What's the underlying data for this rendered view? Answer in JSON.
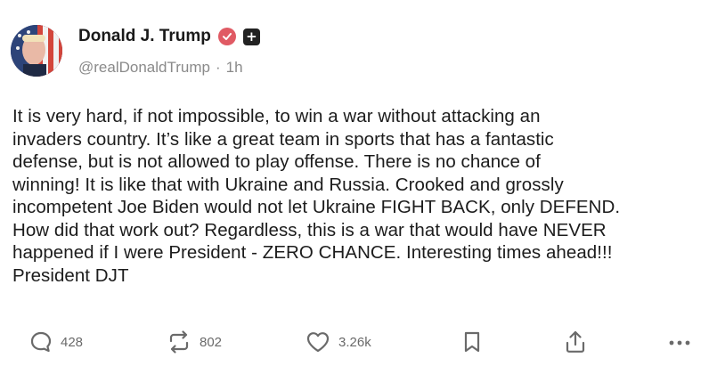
{
  "author": {
    "display_name": "Donald J. Trump",
    "handle": "@realDonaldTrump",
    "separator": "·",
    "timestamp": "1h",
    "verified_icon": "verified-check-icon",
    "plus_icon": "plus-icon",
    "plus_label": "+"
  },
  "post": {
    "text": "It is very hard, if not impossible, to win a war without attacking an\ninvaders country. It’s like a great team in sports that has a fantastic\ndefense, but is not allowed to play offense. There is no chance of\nwinning! It is like that with Ukraine and Russia. Crooked and grossly\nincompetent Joe Biden would not let Ukraine FIGHT BACK, only DEFEND.\nHow did that work out? Regardless, this is a war that would have NEVER\nhappened if I were President - ZERO CHANCE. Interesting times ahead!!!\nPresident DJT"
  },
  "actions": {
    "reply_count": "428",
    "repost_count": "802",
    "like_count": "3.26k",
    "reply_icon": "reply-icon",
    "repost_icon": "repost-icon",
    "like_icon": "heart-icon",
    "bookmark_icon": "bookmark-icon",
    "share_icon": "share-icon",
    "more_icon": "more-icon"
  },
  "colors": {
    "verified_badge": "#e05a64",
    "muted_text": "#8a8a8a",
    "icon_gray": "#6a6a6a"
  }
}
